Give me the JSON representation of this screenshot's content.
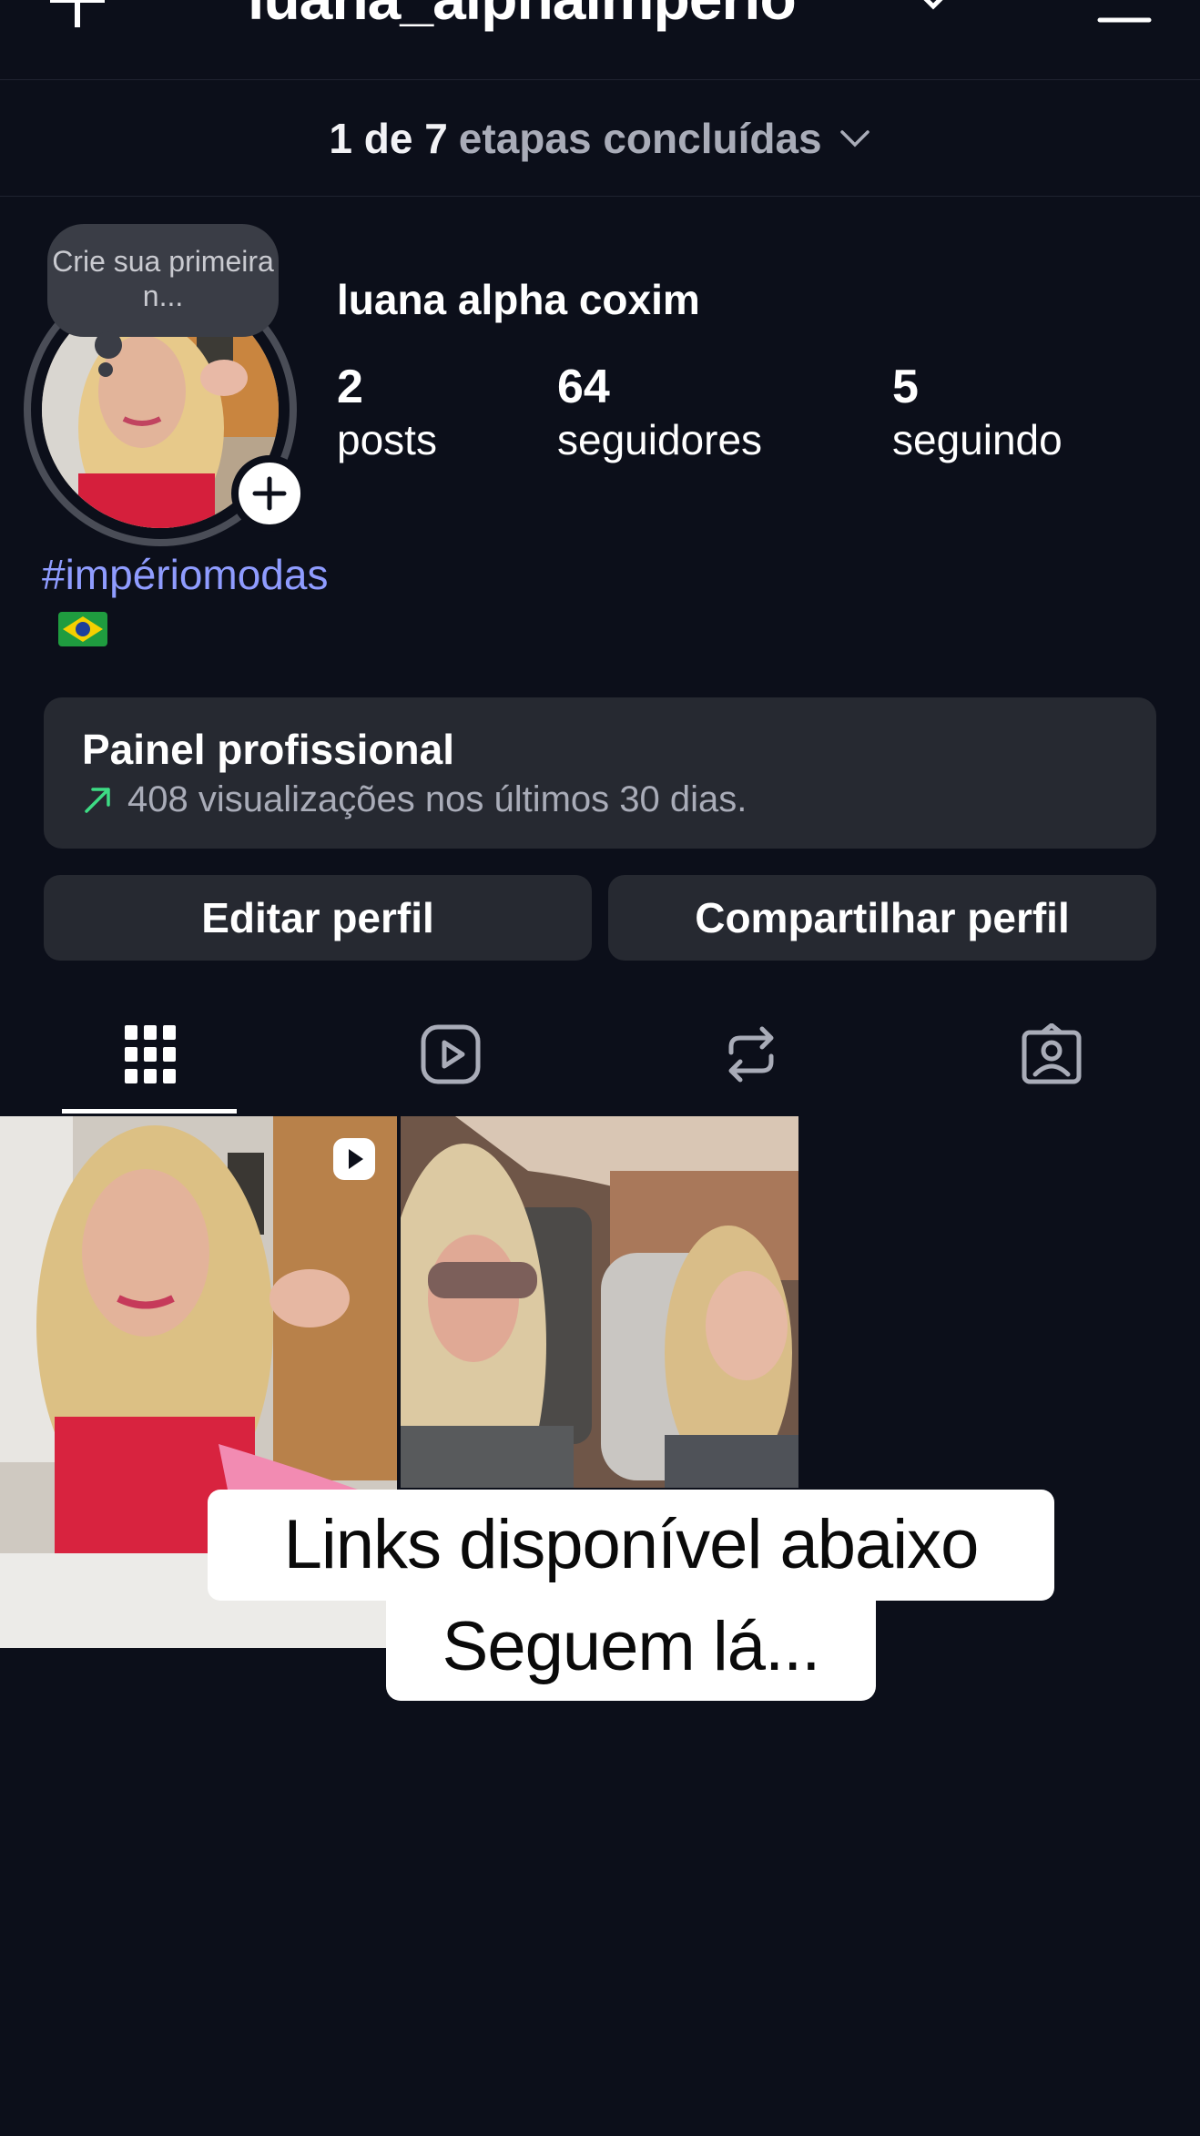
{
  "header": {
    "username": "luana_alphaimperio"
  },
  "steps": {
    "count": "1 de 7",
    "label": "etapas concluídas"
  },
  "profile": {
    "note": "Crie sua primeira n...",
    "display_name": "luana alpha coxim",
    "stats": [
      {
        "value": "2",
        "label": "posts"
      },
      {
        "value": "64",
        "label": "seguidores"
      },
      {
        "value": "5",
        "label": "seguindo"
      }
    ],
    "bio_tag": "#impériomodas"
  },
  "pro_panel": {
    "title": "Painel profissional",
    "subtitle": "408 visualizações nos últimos 30 dias."
  },
  "buttons": {
    "edit": "Editar perfil",
    "share": "Compartilhar perfil"
  },
  "tabs": [
    {
      "icon": "grid-icon",
      "active": true
    },
    {
      "icon": "reels-icon",
      "active": false
    },
    {
      "icon": "repost-icon",
      "active": false
    },
    {
      "icon": "tagged-icon",
      "active": false
    }
  ],
  "overlay": {
    "line1": "Links disponível abaixo",
    "line2": "Seguem lá..."
  },
  "colors": {
    "background": "#0c0f1a",
    "panel": "#262931",
    "hashtag": "#8f9cff",
    "trend": "#3ddc84"
  }
}
